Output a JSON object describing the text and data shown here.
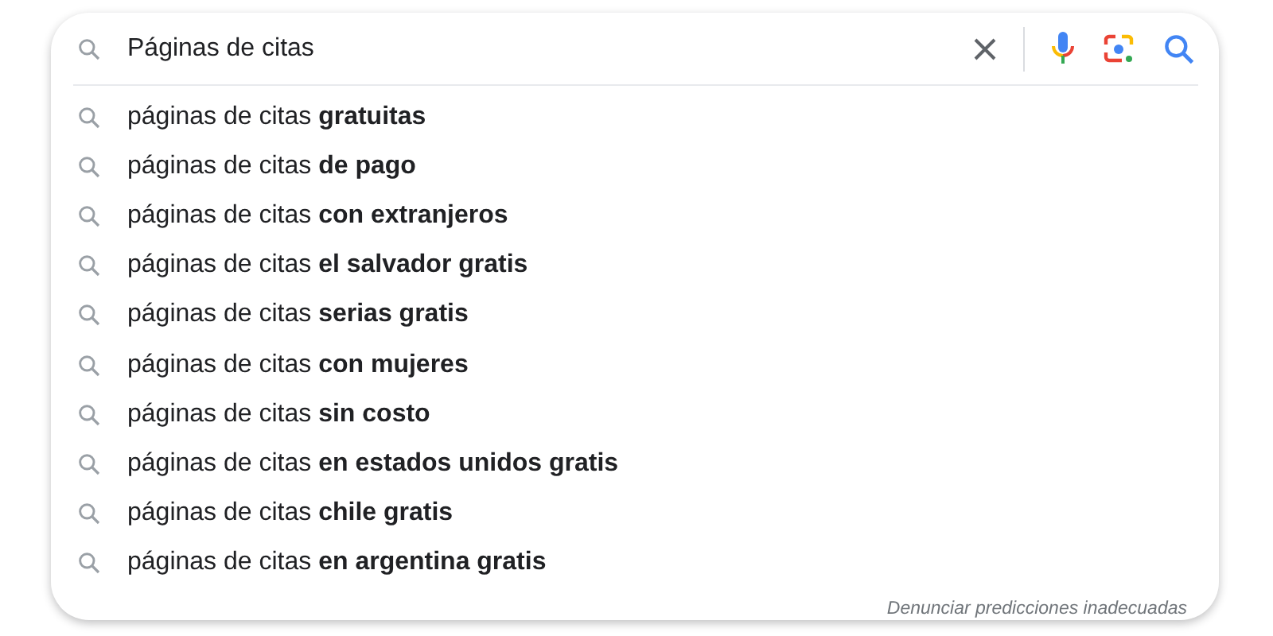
{
  "search": {
    "value": "Páginas de citas"
  },
  "suggestions": [
    {
      "text": "páginas de citas **gratuitas**"
    },
    {
      "text": "páginas de citas **de pago**"
    },
    {
      "text": "páginas de citas **con extranjeros**"
    },
    {
      "text": "páginas de citas **el salvador gratis**"
    },
    {
      "text": "páginas de citas **serias gratis**"
    },
    {
      "text": "páginas de citas **con mujeres**"
    },
    {
      "text": "páginas de citas **sin costo**"
    },
    {
      "text": "páginas de citas **en estados unidos gratis**"
    },
    {
      "text": "páginas de citas **chile gratis**"
    },
    {
      "text": "páginas de citas **en argentina gratis**"
    }
  ],
  "footer_link": "Denunciar predicciones inadecuadas"
}
